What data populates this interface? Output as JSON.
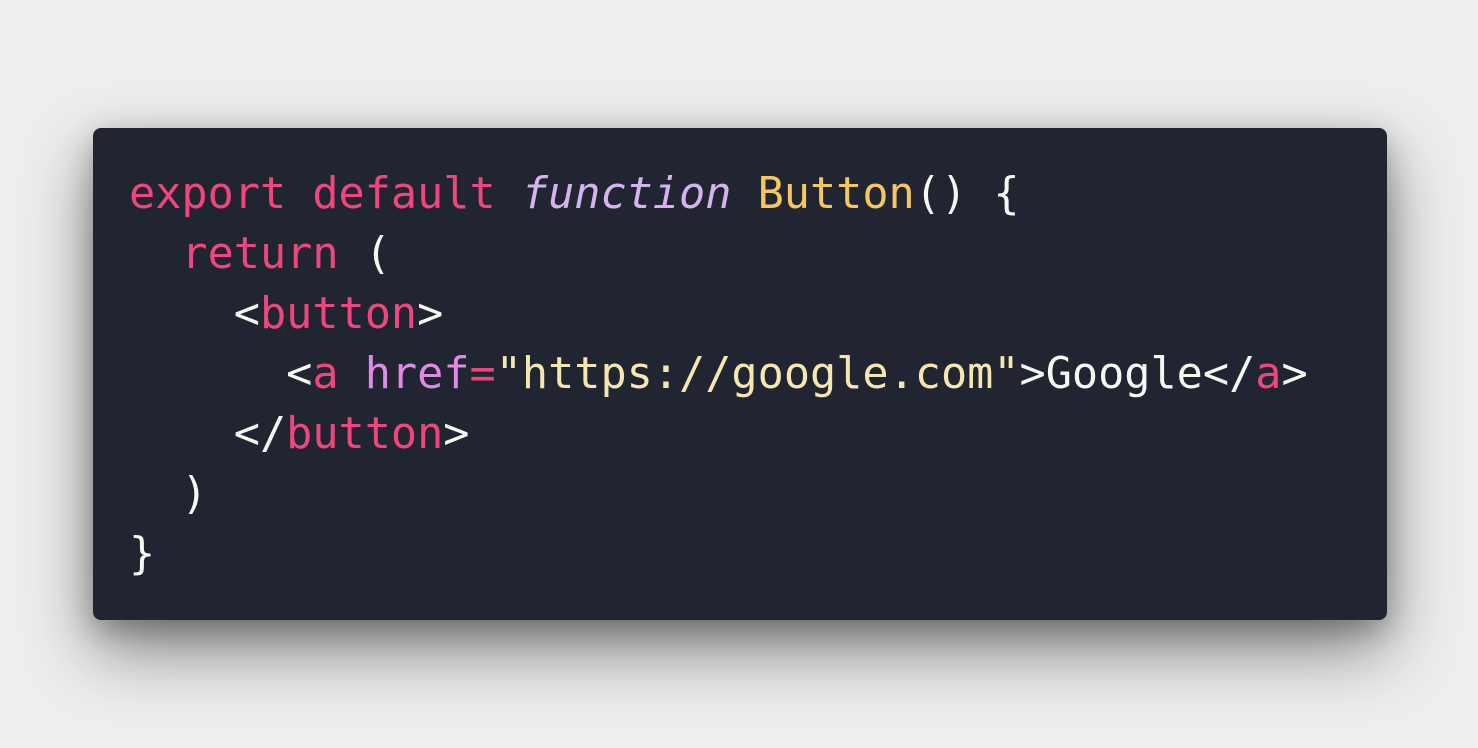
{
  "code": {
    "line1": {
      "kw_export": "export",
      "sp1": " ",
      "kw_default": "default",
      "sp2": " ",
      "kw_function": "function",
      "sp3": " ",
      "fn_name": "Button",
      "parens": "()",
      "sp4": " ",
      "brace_open": "{"
    },
    "line2": {
      "indent": "  ",
      "kw_return": "return",
      "sp": " ",
      "paren_open": "("
    },
    "line3": {
      "indent": "    ",
      "lt": "<",
      "tag": "button",
      "gt": ">"
    },
    "line4": {
      "indent": "      ",
      "lt": "<",
      "tag": "a",
      "sp": " ",
      "attr": "href",
      "eq": "=",
      "quote_open": "\"",
      "url": "https://google.com",
      "quote_close": "\"",
      "gt": ">",
      "text": "Google",
      "lt_close": "</",
      "tag_close": "a",
      "gt_close": ">"
    },
    "line5": {
      "indent": "    ",
      "lt": "</",
      "tag": "button",
      "gt": ">"
    },
    "line6": {
      "indent": "  ",
      "paren_close": ")"
    },
    "line7": {
      "brace_close": "}"
    }
  }
}
